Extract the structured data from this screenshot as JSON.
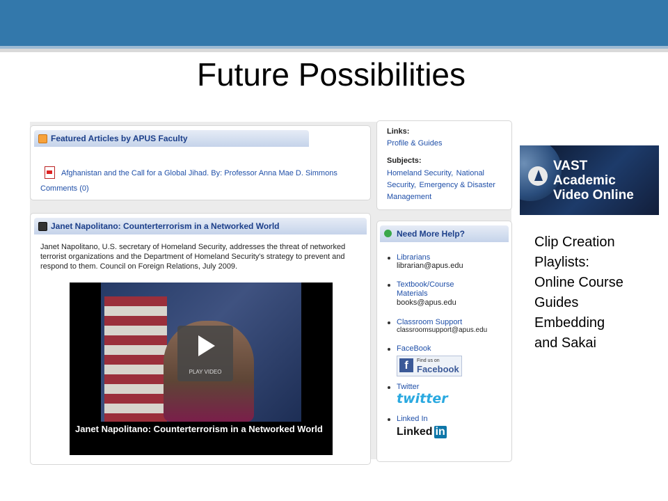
{
  "slide": {
    "title": "Future Possibilities",
    "side_list": [
      "Clip Creation",
      "Playlists:",
      "Online Course",
      "Guides",
      "Embedding",
      "and Sakai"
    ]
  },
  "featured": {
    "header": "Featured Articles by APUS Faculty",
    "article": "Afghanistan and the Call for a Global Jihad. By: Professor Anna Mae D. Simmons",
    "comments": "Comments (0)"
  },
  "links_panel": {
    "links_label": "Links:",
    "profile_link": "Profile & Guides",
    "subjects_label": "Subjects:",
    "subject_links": [
      "Homeland Security",
      "National Security",
      "Emergency & Disaster Management"
    ],
    "separator": ","
  },
  "video_panel": {
    "header": "Janet Napolitano: Counterterrorism in a Networked World",
    "description": "Janet Napolitano, U.S. secretary of Homeland Security, addresses the threat of networked terrorist organizations and the Department of Homeland Security's strategy to prevent and respond to them. Council on Foreign Relations, July 2009.",
    "play_label": "PLAY VIDEO",
    "caption": "Janet Napolitano: Counterterrorism in a Networked World"
  },
  "help_panel": {
    "header": "Need More Help?",
    "items": [
      {
        "label": "Librarians",
        "detail": "librarian@apus.edu"
      },
      {
        "label": "Textbook/Course Materials",
        "detail": "books@apus.edu"
      },
      {
        "label": "Classroom Support",
        "detail": "classroomsupport@apus.edu"
      },
      {
        "label": "FaceBook",
        "detail": ""
      },
      {
        "label": "Twitter",
        "detail": ""
      },
      {
        "label": "Linked In",
        "detail": ""
      }
    ],
    "facebook_badge": {
      "small": "Find us on",
      "big": "Facebook",
      "f": "f"
    },
    "twitter_logo": "twitter",
    "linkedin_logo": {
      "word": "Linked",
      "box": "in"
    }
  },
  "vast": {
    "line1": "VAST",
    "line2": "Academic",
    "line3": "Video Online"
  },
  "colors": {
    "topbar": "#3378ab",
    "link": "#1f4fa8",
    "header_text": "#1c3f8a"
  }
}
